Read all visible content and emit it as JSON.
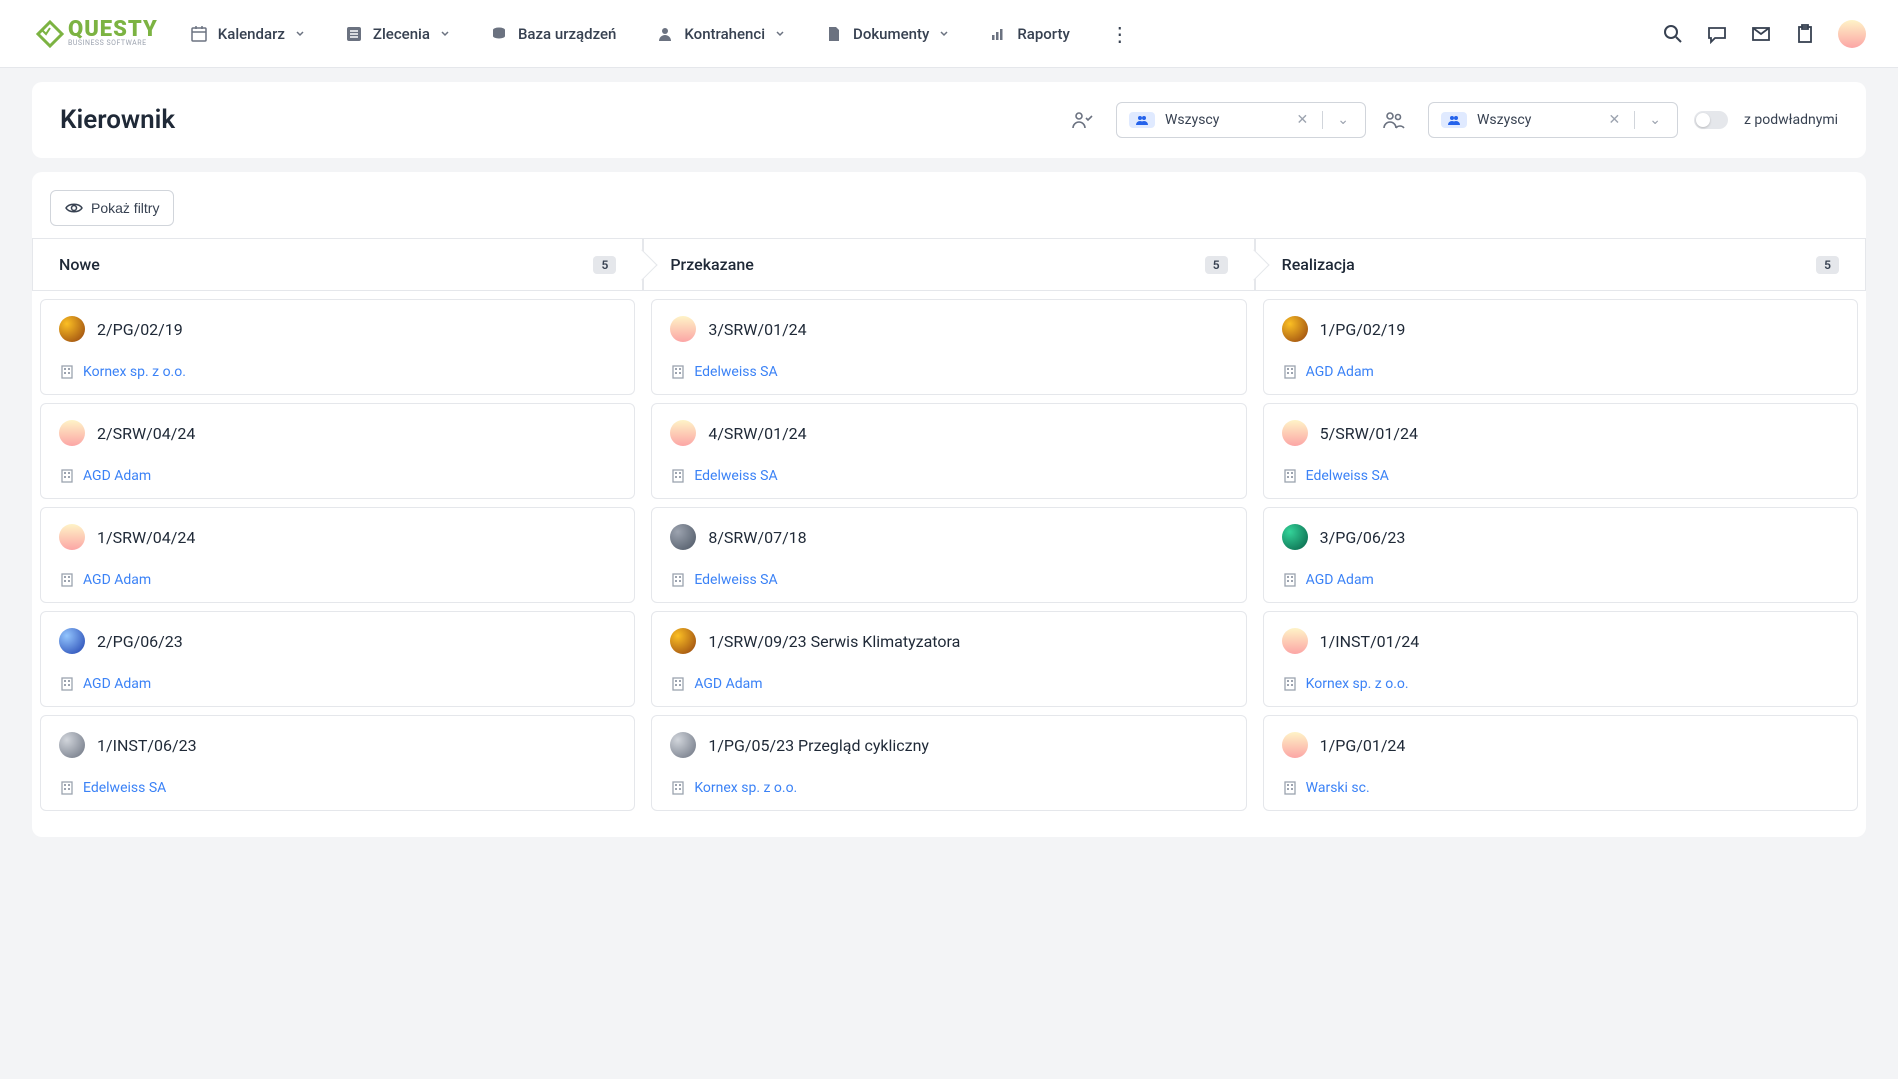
{
  "brand": {
    "name": "QUESTY",
    "sub": "BUSINESS SOFTWARE"
  },
  "nav": {
    "calendar": "Kalendarz",
    "orders": "Zlecenia",
    "devices": "Baza urządzeń",
    "contractors": "Kontrahenci",
    "documents": "Dokumenty",
    "reports": "Raporty"
  },
  "page": {
    "title": "Kierownik",
    "filter1": {
      "value": "Wszyscy"
    },
    "filter2": {
      "value": "Wszyscy"
    },
    "toggleLabel": "z podwładnymi"
  },
  "filtersButton": "Pokaż filtry",
  "columns": [
    {
      "title": "Nowe",
      "count": "5",
      "cards": [
        {
          "title": "2/PG/02/19",
          "company": "Kornex sp. z o.o.",
          "av": "av-a"
        },
        {
          "title": "2/SRW/04/24",
          "company": "AGD Adam",
          "av": "av-b"
        },
        {
          "title": "1/SRW/04/24",
          "company": "AGD Adam",
          "av": "av-b"
        },
        {
          "title": "2/PG/06/23",
          "company": "AGD Adam",
          "av": "av-e"
        },
        {
          "title": "1/INST/06/23",
          "company": "Edelweiss SA",
          "av": "av-f"
        }
      ]
    },
    {
      "title": "Przekazane",
      "count": "5",
      "cards": [
        {
          "title": "3/SRW/01/24",
          "company": "Edelweiss SA",
          "av": "av-b"
        },
        {
          "title": "4/SRW/01/24",
          "company": "Edelweiss SA",
          "av": "av-b"
        },
        {
          "title": "8/SRW/07/18",
          "company": "Edelweiss SA",
          "av": "av-c"
        },
        {
          "title": "1/SRW/09/23 Serwis Klimatyzatora",
          "company": "AGD Adam",
          "av": "av-a"
        },
        {
          "title": "1/PG/05/23 Przegląd cykliczny",
          "company": "Kornex sp. z o.o.",
          "av": "av-f"
        }
      ]
    },
    {
      "title": "Realizacja",
      "count": "5",
      "cards": [
        {
          "title": "1/PG/02/19",
          "company": "AGD Adam",
          "av": "av-a"
        },
        {
          "title": "5/SRW/01/24",
          "company": "Edelweiss SA",
          "av": "av-b"
        },
        {
          "title": "3/PG/06/23",
          "company": "AGD Adam",
          "av": "av-d"
        },
        {
          "title": "1/INST/01/24",
          "company": "Kornex sp. z o.o.",
          "av": "av-b"
        },
        {
          "title": "1/PG/01/24",
          "company": "Warski sc.",
          "av": "av-b"
        }
      ]
    }
  ]
}
